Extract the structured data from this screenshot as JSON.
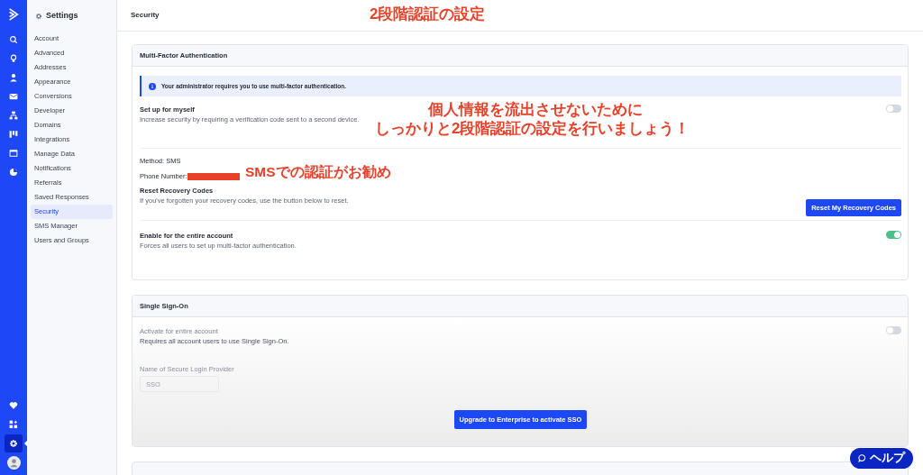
{
  "rail_items": [
    {
      "selected": false
    },
    {
      "selected": false
    },
    {
      "selected": false
    },
    {
      "selected": false
    },
    {
      "selected": false
    },
    {
      "selected": false
    },
    {
      "selected": false
    },
    {
      "selected": false
    },
    {
      "selected": false
    },
    {
      "selected": false
    },
    {
      "selected": false
    },
    {
      "selected": true
    },
    {
      "selected": false
    }
  ],
  "sidebar": {
    "title": "Settings",
    "items": [
      {
        "label": "Account",
        "selected": false
      },
      {
        "label": "Advanced",
        "selected": false
      },
      {
        "label": "Addresses",
        "selected": false
      },
      {
        "label": "Appearance",
        "selected": false
      },
      {
        "label": "Conversions",
        "selected": false
      },
      {
        "label": "Developer",
        "selected": false
      },
      {
        "label": "Domains",
        "selected": false
      },
      {
        "label": "Integrations",
        "selected": false
      },
      {
        "label": "Manage Data",
        "selected": false
      },
      {
        "label": "Notifications",
        "selected": false
      },
      {
        "label": "Referrals",
        "selected": false
      },
      {
        "label": "Saved Responses",
        "selected": false
      },
      {
        "label": "Security",
        "selected": true
      },
      {
        "label": "SMS Manager",
        "selected": false
      },
      {
        "label": "Users and Groups",
        "selected": false
      }
    ]
  },
  "page_title": "Security",
  "mfa": {
    "title": "Multi-Factor Authentication",
    "alert": "Your administrator requires you to use multi-factor authentication.",
    "setup": {
      "label": "Set up for myself",
      "description": "Increase security by requiring a verification code sent to a second device.",
      "on": false
    },
    "method": "Method: SMS",
    "phone_label": "Phone Number:",
    "phone_redacted": true,
    "reset": {
      "label": "Reset Recovery Codes",
      "description": "If you've forgotten your recovery codes, use the button below to reset.",
      "button": "Reset My Recovery Codes"
    },
    "enable_all": {
      "label": "Enable for the entire account",
      "description": "Forces all users to set up multi-factor authentication.",
      "on": true
    }
  },
  "sso": {
    "title": "Single Sign-On",
    "disabled": true,
    "activate": {
      "label": "Activate for entire account",
      "description": "Requires all account users to use Single Sign-On.",
      "on": false
    },
    "provider_label": "Name of Secure Login Provider",
    "provider_placeholder": "SSO",
    "button": "Upgrade to Enterprise to activate SSO"
  },
  "next_card": {
    "cut": true
  },
  "annotations": [
    {
      "text": "2段階認証の設定"
    },
    {
      "text": "個人情報を流出させないために"
    },
    {
      "text": "しっかりと2段階認証の設定を行いましょう！"
    },
    {
      "text": "SMSでの認証がお勧め"
    }
  ],
  "help_button": "ヘルプ"
}
